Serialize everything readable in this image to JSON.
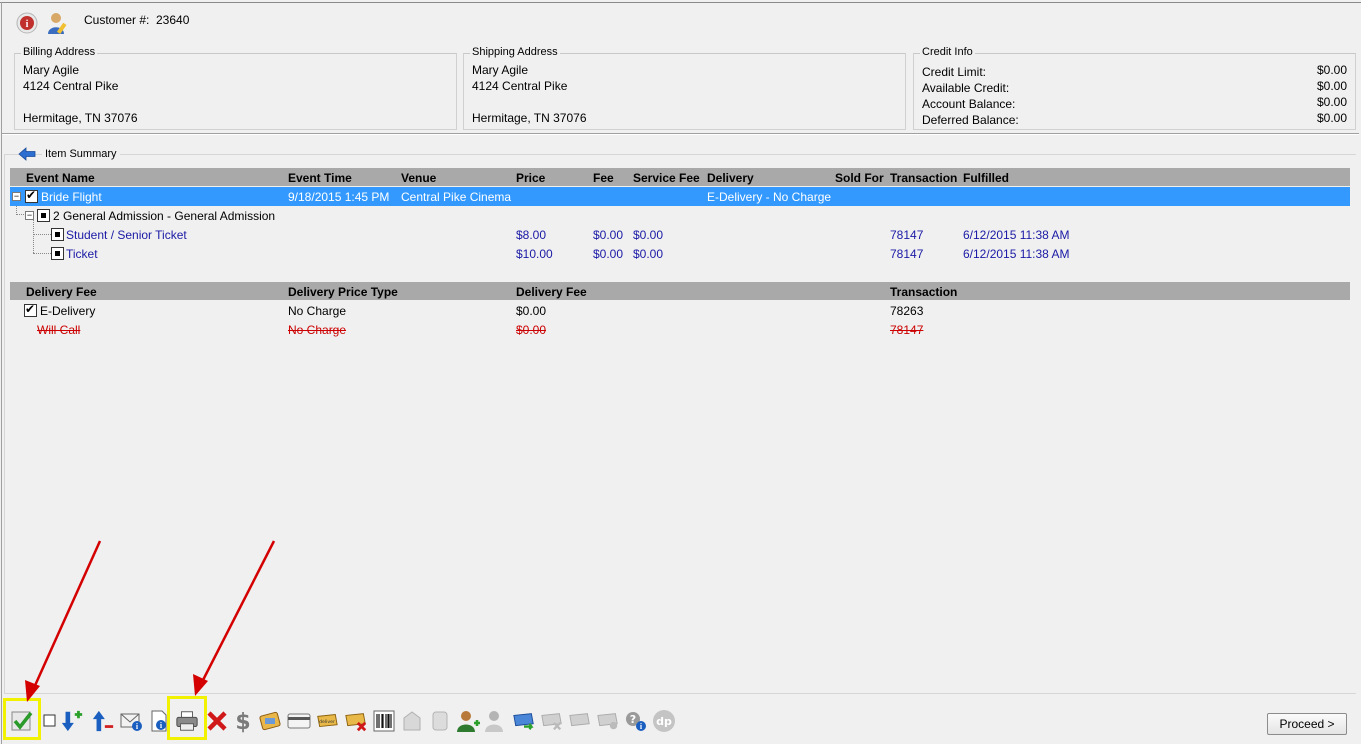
{
  "customer": {
    "label": "Customer #:",
    "number": "23640"
  },
  "billing": {
    "title": "Billing Address",
    "name": "Mary Agile",
    "street": "4124 Central Pike",
    "city": "Hermitage, TN 37076"
  },
  "shipping": {
    "title": "Shipping Address",
    "name": "Mary Agile",
    "street": "4124 Central Pike",
    "city": "Hermitage, TN 37076"
  },
  "credit": {
    "title": "Credit Info",
    "rows": [
      {
        "label": "Credit Limit:",
        "value": "$0.00"
      },
      {
        "label": "Available Credit:",
        "value": "$0.00"
      },
      {
        "label": "Account Balance:",
        "value": "$0.00"
      },
      {
        "label": "Deferred Balance:",
        "value": "$0.00"
      }
    ]
  },
  "summary": {
    "title": "Item Summary"
  },
  "items_grid": {
    "headers": [
      "Event Name",
      "Event Time",
      "Venue",
      "Price",
      "Fee",
      "Service Fee",
      "Delivery",
      "Sold For",
      "Transaction",
      "Fulfilled"
    ],
    "event": {
      "name": "Bride Flight",
      "time": "9/18/2015 1:45 PM",
      "venue": "Central Pike Cinema",
      "delivery": "E-Delivery - No Charge"
    },
    "group": {
      "label": "2 General Admission - General Admission"
    },
    "tickets": [
      {
        "name": "Student / Senior Ticket",
        "price": "$8.00",
        "fee": "$0.00",
        "service_fee": "$0.00",
        "transaction": "78147",
        "fulfilled": "6/12/2015 11:38 AM"
      },
      {
        "name": "Ticket",
        "price": "$10.00",
        "fee": "$0.00",
        "service_fee": "$0.00",
        "transaction": "78147",
        "fulfilled": "6/12/2015 11:38 AM"
      }
    ]
  },
  "delivery_grid": {
    "headers": [
      "Delivery Fee",
      "Delivery Price Type",
      "Delivery Fee",
      "Transaction"
    ],
    "rows": [
      {
        "name": "E-Delivery",
        "price_type": "No Charge",
        "fee": "$0.00",
        "transaction": "78263",
        "checked": true,
        "struck": false
      },
      {
        "name": "Will Call",
        "price_type": "No Charge",
        "fee": "$0.00",
        "transaction": "78147",
        "checked": false,
        "struck": true
      }
    ]
  },
  "toolbar": {
    "icons": [
      "checkmark-icon",
      "checkbox-icon",
      "move-down-icon",
      "move-up-remove-icon",
      "email-info-icon",
      "document-info-icon",
      "printer-icon",
      "delete-icon",
      "dollar-icon",
      "ticket-icon",
      "card-icon",
      "delivery-icon",
      "delivery-remove-icon",
      "barcode-icon",
      "envelope-gray-icon",
      "scroll-gray-icon",
      "user-add-icon",
      "user-gray-icon",
      "delivery-forward-icon",
      "ticket-remove-gray-icon",
      "ticket-gray-icon",
      "ticket-info-gray-icon",
      "question-icon",
      "dp-icon"
    ],
    "proceed_label": "Proceed >"
  },
  "colors": {
    "selection": "#3399ff",
    "grid_header": "#a9a9a9",
    "link_blue": "#1a1aa6",
    "strike_red": "#cc0000",
    "highlight": "#f2f200",
    "arrow_red": "#d40000"
  }
}
